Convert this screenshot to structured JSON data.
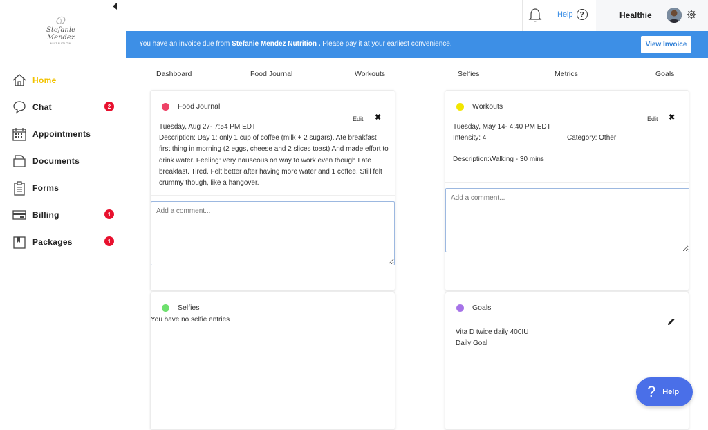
{
  "sidebar": {
    "logo": {
      "name": "Stefanie Mendez",
      "subtitle": "NUTRITION"
    },
    "items": [
      {
        "label": "Home",
        "icon": "home-icon",
        "active": true,
        "badge": ""
      },
      {
        "label": "Chat",
        "icon": "chat-icon",
        "active": false,
        "badge": "2"
      },
      {
        "label": "Appointments",
        "icon": "calendar-icon",
        "active": false,
        "badge": ""
      },
      {
        "label": "Documents",
        "icon": "document-icon",
        "active": false,
        "badge": ""
      },
      {
        "label": "Forms",
        "icon": "clipboard-icon",
        "active": false,
        "badge": ""
      },
      {
        "label": "Billing",
        "icon": "credit-card-icon",
        "active": false,
        "badge": "1"
      },
      {
        "label": "Packages",
        "icon": "package-icon",
        "active": false,
        "badge": "1"
      }
    ]
  },
  "topbar": {
    "help_label": "Help",
    "help_icon": "?",
    "user_name": "Healthie"
  },
  "banner": {
    "text_before": "You have an invoice due from ",
    "provider": "Stefanie Mendez Nutrition .",
    "text_after": " Please pay it at your earliest convenience.",
    "button_label": "View Invoice"
  },
  "tabs": [
    "Dashboard",
    "Food Journal",
    "Workouts",
    "Selfies",
    "Metrics",
    "Goals"
  ],
  "cards": {
    "food_journal": {
      "title": "Food Journal",
      "dot_color": "#ee4266",
      "edit_label": "Edit",
      "close_glyph": "✖",
      "date": "Tuesday, Aug 27- 7:54 PM EDT",
      "description": "Description: Day 1: only 1 cup of coffee (milk + 2 sugars). Ate breakfast first thing in morning (2 eggs, cheese and 2 slices toast) And made effort to drink water. Feeling: very nauseous on way to work even though I ate breakfast. Tired. Felt better after having more water and 1 coffee. Still felt crummy though, like a hangover.",
      "comment_placeholder": "Add a comment..."
    },
    "workouts": {
      "title": "Workouts",
      "dot_color": "#f2e600",
      "edit_label": "Edit",
      "close_glyph": "✖",
      "date": "Tuesday, May 14- 4:40 PM EDT",
      "intensity": "Intensity: 4",
      "category": "Category: Other",
      "description": "Description:Walking - 30 mins",
      "comment_placeholder": "Add a comment..."
    },
    "selfies": {
      "title": "Selfies",
      "dot_color": "#6ee06e",
      "empty_text": "You have no selfie entries"
    },
    "goals": {
      "title": "Goals",
      "dot_color": "#a673e8",
      "goal_name": "Vita D twice daily 400IU",
      "goal_freq": "Daily Goal"
    }
  },
  "help_fab": {
    "icon": "?",
    "label": "Help"
  }
}
